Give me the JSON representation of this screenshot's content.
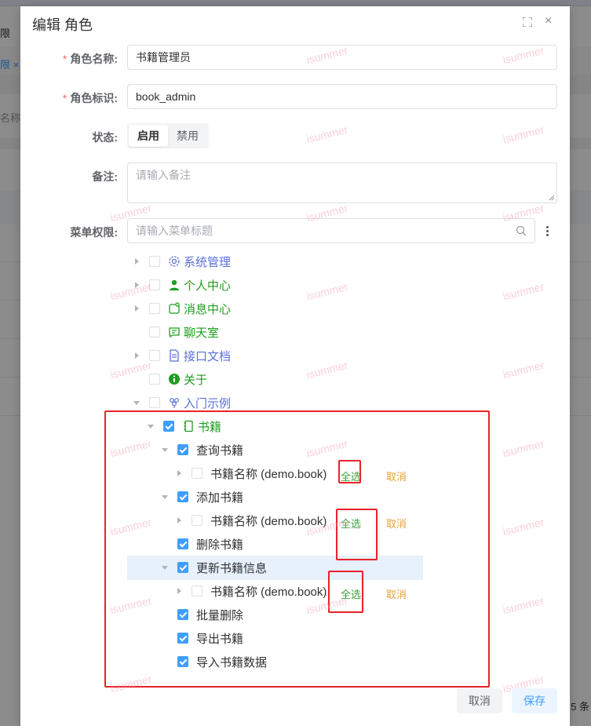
{
  "background": {
    "fragments": [
      "限",
      "限 ×",
      "名称"
    ],
    "pager_text": "5 条"
  },
  "dialog": {
    "title": "编辑 角色",
    "close_glyph": "×"
  },
  "form": {
    "required_mark": "*",
    "role_name_label": "角色名称:",
    "role_name_value": "书籍管理员",
    "role_key_label": "角色标识:",
    "role_key_value": "book_admin",
    "status_label": "状态:",
    "status_options": [
      "启用",
      "禁用"
    ],
    "status_selected": "启用",
    "remark_label": "备注:",
    "remark_placeholder": "请输入备注",
    "menu_label": "菜单权限:",
    "menu_search_placeholder": "请输入菜单标题"
  },
  "tree": {
    "nodes": [
      {
        "label": "系统管理",
        "icon": "gear-icon"
      },
      {
        "label": "个人中心",
        "icon": "user-icon"
      },
      {
        "label": "消息中心",
        "icon": "message-icon"
      },
      {
        "label": "聊天室",
        "icon": "chat-icon"
      },
      {
        "label": "接口文档",
        "icon": "document-icon"
      },
      {
        "label": "关于",
        "icon": "info-icon"
      },
      {
        "label": "入门示例",
        "icon": "grape-icon"
      },
      {
        "label": "书籍",
        "icon": "book-icon"
      },
      {
        "label": "查询书籍"
      },
      {
        "label": "书籍名称 (demo.book)"
      },
      {
        "label": "添加书籍"
      },
      {
        "label": "书籍名称 (demo.book)"
      },
      {
        "label": "删除书籍"
      },
      {
        "label": "更新书籍信息"
      },
      {
        "label": "书籍名称 (demo.book)"
      },
      {
        "label": "批量删除"
      },
      {
        "label": "导出书籍"
      },
      {
        "label": "导入书籍数据"
      }
    ],
    "select_all_label": "全选",
    "cancel_label": "取消"
  },
  "footer": {
    "cancel_label": "取消",
    "save_label": "保存"
  },
  "watermark": "isummer",
  "colors": {
    "primary": "#409eff",
    "menu_blue": "#5b6fd6",
    "menu_green": "#1f9d1f",
    "required": "#f56c6c",
    "annotation_red": "#e8222a",
    "orange": "#e6a23c"
  }
}
